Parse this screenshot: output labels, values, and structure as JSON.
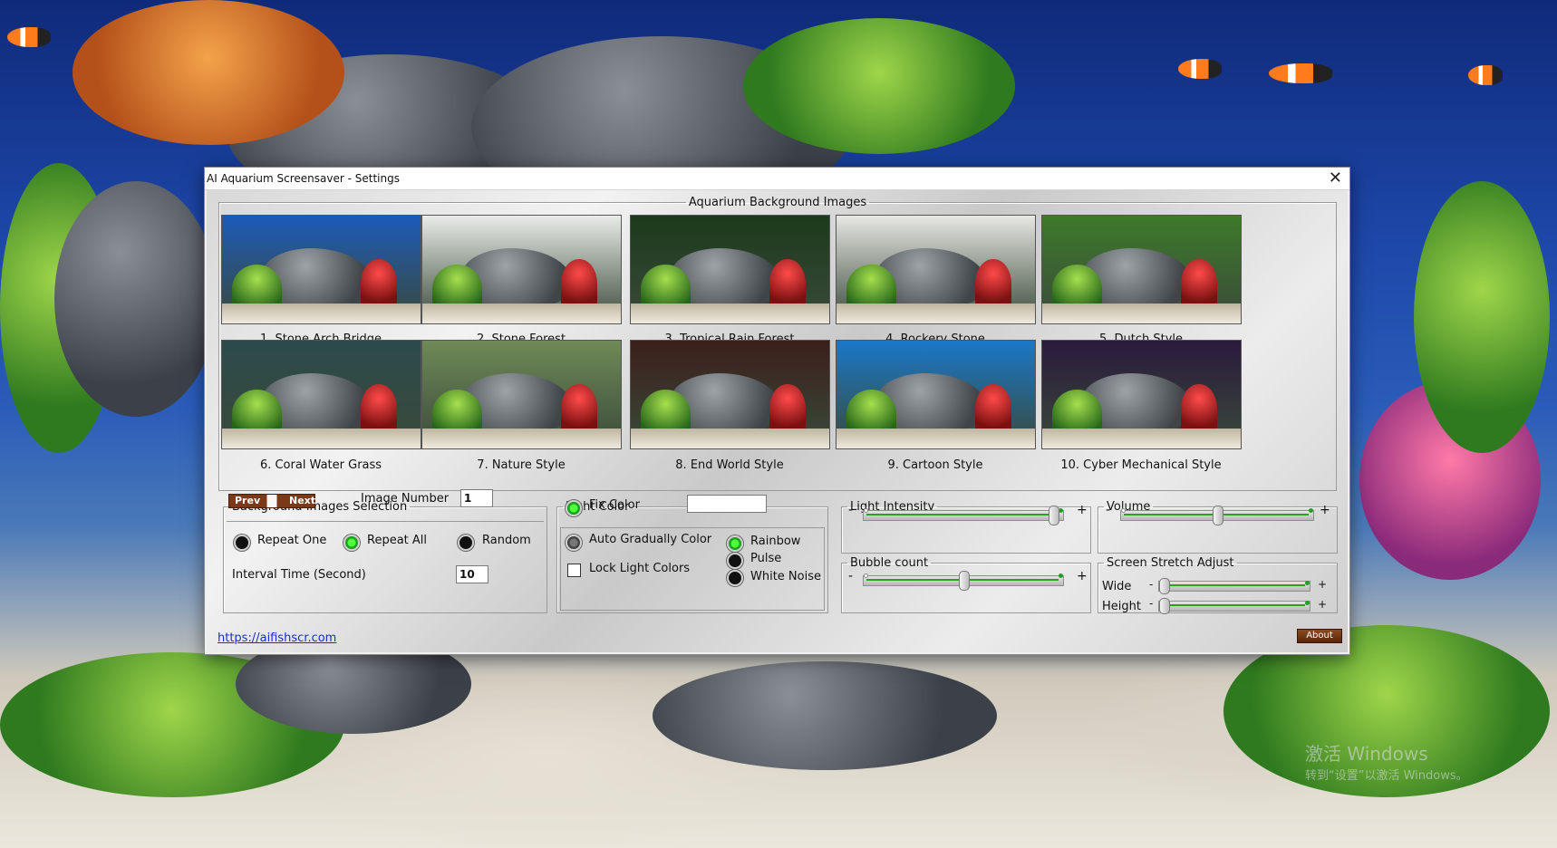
{
  "window": {
    "title": "AI Aquarium Screensaver - Settings",
    "close_glyph": "✕"
  },
  "gallery": {
    "legend": "Aquarium Background Images",
    "images": [
      {
        "caption": "1. Stone Arch Bridge",
        "sky": "#1d5ab8"
      },
      {
        "caption": "2. Stone Forest",
        "sky": "#e9ece8"
      },
      {
        "caption": "3. Tropical Rain Forest",
        "sky": "#1c3a1c"
      },
      {
        "caption": "4. Rockery Stone",
        "sky": "#e7e7e3"
      },
      {
        "caption": "5. Dutch Style",
        "sky": "#3d7a2b"
      },
      {
        "caption": "6. Coral Water Grass",
        "sky": "#2c4a4c"
      },
      {
        "caption": "7. Nature Style",
        "sky": "#6f8a57"
      },
      {
        "caption": "8.  End  World Style",
        "sky": "#3b1f1b"
      },
      {
        "caption": "9. Cartoon Style",
        "sky": "#1a78c8"
      },
      {
        "caption": "10. Cyber Mechanical Style",
        "sky": "#2a1a3c"
      }
    ]
  },
  "bg_selection": {
    "legend": "Background Images Selection",
    "prev_label": "Prev",
    "next_label": "Next",
    "image_number_label": "Image Number",
    "image_number_value": "1",
    "repeat_one_label": "Repeat One",
    "repeat_all_label": "Repeat All",
    "random_label": "Random",
    "selected_mode": "Repeat All",
    "interval_label": "Interval Time (Second)",
    "interval_value": "10"
  },
  "light_color": {
    "legend": "Light Color",
    "fix_color_label": "Fix Color",
    "fix_color_value": "",
    "auto_gradually_label": "Auto Gradually Color",
    "lock_label": "Lock Light Colors",
    "lock_checked": false,
    "rainbow_label": "Rainbow",
    "pulse_label": "Pulse",
    "white_noise_label": "White Noise",
    "selected_effect": "Rainbow"
  },
  "light_intensity": {
    "legend": "Light Intensity",
    "minus": "-",
    "plus": "+",
    "level": 0.97
  },
  "bubble_count": {
    "legend": "Bubble count",
    "minus": "-",
    "plus": "+",
    "level": 0.5
  },
  "volume": {
    "legend": "Volume",
    "minus": "-",
    "plus": "+",
    "level": 0.5
  },
  "stretch": {
    "legend": "Screen Stretch Adjust",
    "wide_label": "Wide",
    "height_label": "Height",
    "minus": "-",
    "plus": "+",
    "wide_level": 0.0,
    "height_level": 0.0
  },
  "footer": {
    "link": "https://aifishscr.com",
    "about_label": "About"
  },
  "watermark": {
    "line1": "激活 Windows",
    "line2": "转到“设置”以激活 Windows。"
  }
}
